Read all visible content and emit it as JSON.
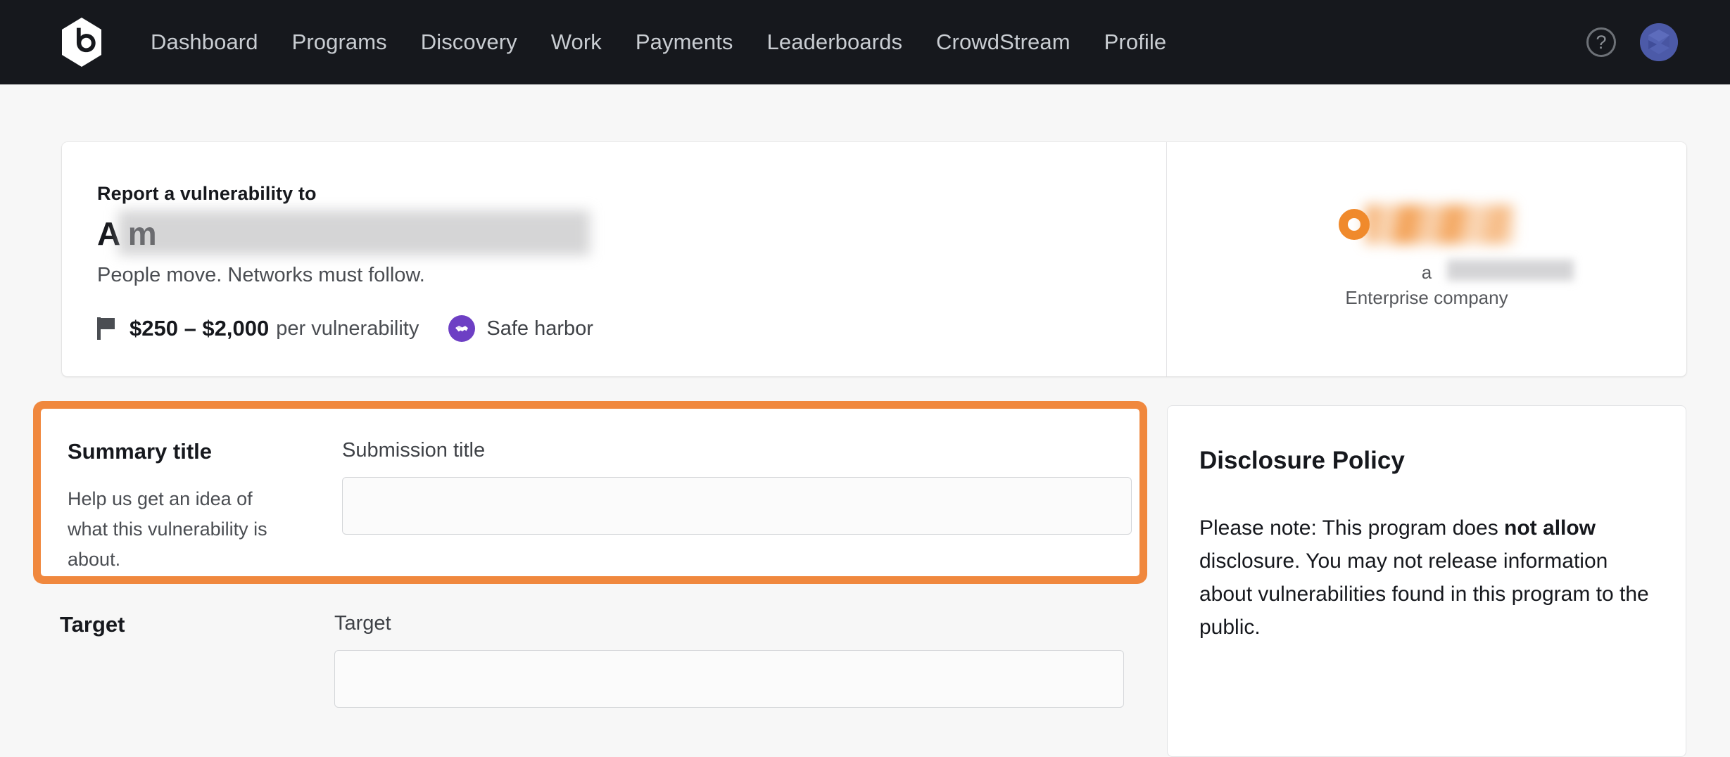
{
  "nav": {
    "logo_name": "bugcrowd-logo",
    "links": [
      {
        "label": "Dashboard"
      },
      {
        "label": "Programs"
      },
      {
        "label": "Discovery"
      },
      {
        "label": "Work"
      },
      {
        "label": "Payments"
      },
      {
        "label": "Leaderboards"
      },
      {
        "label": "CrowdStream"
      },
      {
        "label": "Profile"
      }
    ],
    "help_glyph": "?",
    "bar_color": "#16181d",
    "link_color": "#c9cdd2",
    "avatar_color": "#4c5aa8"
  },
  "program": {
    "kicker": "Report a vulnerability to",
    "title": "A                                        m",
    "tagline": "People move. Networks must follow.",
    "reward_amount": "$250 – $2,000",
    "reward_unit": "per vulnerability",
    "safe_harbor_label": "Safe harbor",
    "safe_harbor_color": "#6d3fc4",
    "sponsor": {
      "sub_line1": "a ",
      "sub_line2": "Enterprise company",
      "brand_color": "#f08a2c"
    }
  },
  "summary_field": {
    "section_title": "Summary title",
    "section_help": "Help us get an idea of what this vulnerability is about.",
    "input_label": "Submission title",
    "input_value": "",
    "input_placeholder": "",
    "highlight_color": "#f0883e"
  },
  "target_field": {
    "section_title": "Target",
    "input_label": "Target",
    "input_value": "",
    "input_placeholder": ""
  },
  "disclosure": {
    "title": "Disclosure Policy",
    "body_part1": "Please note: This program does ",
    "body_bold": "not allow",
    "body_part2": " disclosure. You may not release information about vulnerabilities found in this program to the public."
  }
}
